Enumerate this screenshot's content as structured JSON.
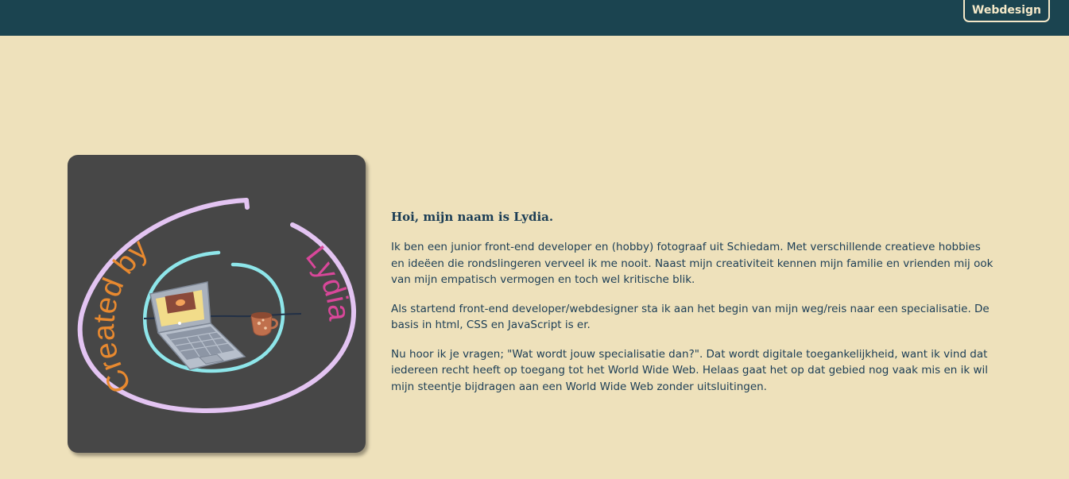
{
  "header": {
    "nav_button_label": "Webdesign"
  },
  "logo": {
    "text_created_by": "Created by",
    "text_name": "Lydia"
  },
  "about": {
    "heading": "Hoi, mijn naam is Lydia.",
    "paragraphs": [
      "Ik ben een junior front-end developer en (hobby) fotograaf uit Schiedam. Met verschillende creatieve hobbies en ideëen die rondslingeren verveel ik me nooit. Naast mijn creativiteit kennen mijn familie en vrienden mij ook van mijn empatisch vermogen en toch wel kritische blik.",
      "Als startend front-end developer/webdesigner sta ik aan het begin van mijn weg/reis naar een specialisatie. De basis in html, CSS en JavaScript is er.",
      "Nu hoor ik je vragen; \"Wat wordt jouw specialisatie dan?\". Dat wordt digitale toegankelijkheid, want ik vind dat iedereen recht heeft op toegang tot het World Wide Web. Helaas gaat het op dat gebied nog vaak mis en ik wil mijn steentje bijdragen aan een World Wide Web zonder uitsluitingen."
    ]
  },
  "colors": {
    "header_bg": "#1b4450",
    "page_bg": "#eee1bb",
    "text": "#1b3d55",
    "logo_bg": "#474747",
    "ring_outer": "#e3c4f2",
    "ring_inner": "#8ee6ea",
    "text_created_by": "#e8892f",
    "text_name": "#d9479a"
  }
}
